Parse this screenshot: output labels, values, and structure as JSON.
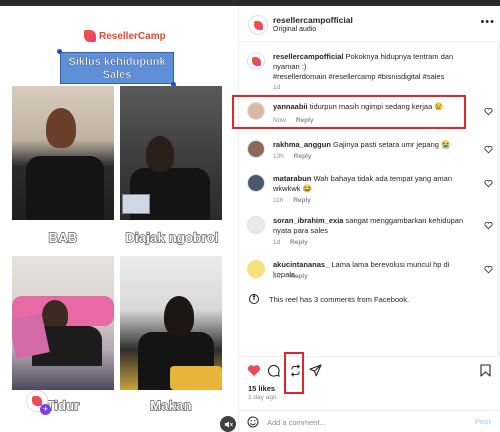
{
  "media": {
    "brand": "ResellerCamp",
    "title_line1": "Siklus kehidupunk",
    "title_line2": "Sales",
    "captions": [
      "BAB",
      "Diajak ngobrol",
      "Tidur",
      "Makan"
    ]
  },
  "post": {
    "username": "resellercampofficial",
    "audio": "Original audio",
    "more_label": "•••"
  },
  "caption": {
    "username": "resellercampofficial",
    "text": "Pokoknya hidupnya tentram dan nyaman :)",
    "tags": "#resellerdomain #resellercamp #bisnisdigital #sales",
    "time": "1d"
  },
  "comments": [
    {
      "username": "yannaabii",
      "text": "tidurpun masih ngimpi sedang kerjaa 😢",
      "time": "Now",
      "reply": "Reply",
      "likes": ""
    },
    {
      "username": "rakhma_anggun",
      "text": "Gajinya pasti setara umr jepang 😭",
      "time": "13h",
      "reply": "Reply",
      "likes": ""
    },
    {
      "username": "matarabun",
      "text": "Wah bahaya tidak ada tempat yang aman wkwkwk 😂",
      "time": "11h",
      "reply": "Reply",
      "likes": ""
    },
    {
      "username": "soran_ibrahim_exia",
      "text": "sangat menggambarkan kehidupan nyata para sales",
      "time": "1d",
      "reply": "Reply",
      "likes": ""
    },
    {
      "username": "akucintananas_",
      "text": "Lama lama berevolusi muncul hp di kepala..",
      "time": "5h",
      "reply": "Reply",
      "likes": ""
    }
  ],
  "facebook_note": "This reel has 3 comments from Facebook.",
  "likes": "15 likes",
  "ago": "1 day ago",
  "add_comment": {
    "placeholder": "Add a comment...",
    "post": "Post"
  },
  "colors": {
    "accent_red": "#ed4956",
    "highlight": "#e0252b",
    "link": "#00376b"
  }
}
